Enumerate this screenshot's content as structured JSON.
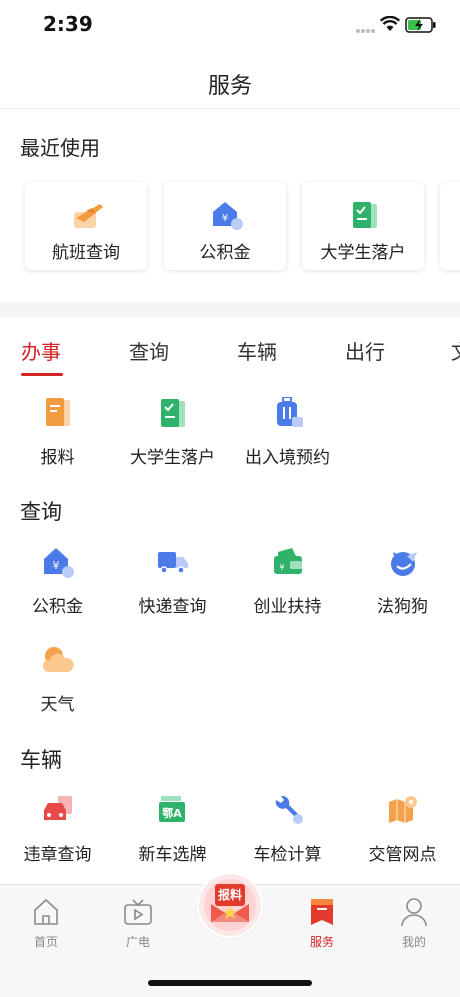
{
  "status_bar": {
    "time": "2:39"
  },
  "nav": {
    "title": "服务"
  },
  "recent": {
    "title": "最近使用",
    "items": [
      {
        "label": "航班查询",
        "icon": "airplane-icon"
      },
      {
        "label": "公积金",
        "icon": "house-fund-icon"
      },
      {
        "label": "大学生落户",
        "icon": "document-check-icon"
      }
    ]
  },
  "tabs": [
    {
      "label": "办事",
      "active": true
    },
    {
      "label": "查询",
      "active": false
    },
    {
      "label": "车辆",
      "active": false
    },
    {
      "label": "出行",
      "active": false
    },
    {
      "label": "文",
      "active": false
    }
  ],
  "banshi": {
    "items": [
      {
        "label": "报料",
        "icon": "report-icon"
      },
      {
        "label": "大学生落户",
        "icon": "document-check-icon"
      },
      {
        "label": "出入境预约",
        "icon": "luggage-icon"
      }
    ]
  },
  "chaxun": {
    "title": "查询",
    "items": [
      {
        "label": "公积金",
        "icon": "house-fund-icon"
      },
      {
        "label": "快递查询",
        "icon": "delivery-truck-icon"
      },
      {
        "label": "创业扶持",
        "icon": "wallet-icon"
      },
      {
        "label": "法狗狗",
        "icon": "dog-icon"
      },
      {
        "label": "天气",
        "icon": "weather-icon"
      }
    ]
  },
  "cheliang": {
    "title": "车辆",
    "items": [
      {
        "label": "违章查询",
        "icon": "car-ticket-icon"
      },
      {
        "label": "新车选牌",
        "icon": "license-plate-icon",
        "plate_text": "鄂A"
      },
      {
        "label": "车检计算",
        "icon": "wrench-icon"
      },
      {
        "label": "交管网点",
        "icon": "map-pin-icon"
      }
    ]
  },
  "tabbar": {
    "items": [
      {
        "label": "首页",
        "icon": "home-icon"
      },
      {
        "label": "广电",
        "icon": "tv-icon"
      },
      {
        "label": "服务",
        "icon": "service-bookmark-icon",
        "active": true
      },
      {
        "label": "我的",
        "icon": "user-icon"
      }
    ],
    "center": {
      "label": "报料",
      "icon": "report-envelope-icon"
    }
  },
  "colors": {
    "accent": "#d42323",
    "orange": "#f5a04a",
    "blue": "#4a7be8",
    "green": "#2fb36b"
  }
}
